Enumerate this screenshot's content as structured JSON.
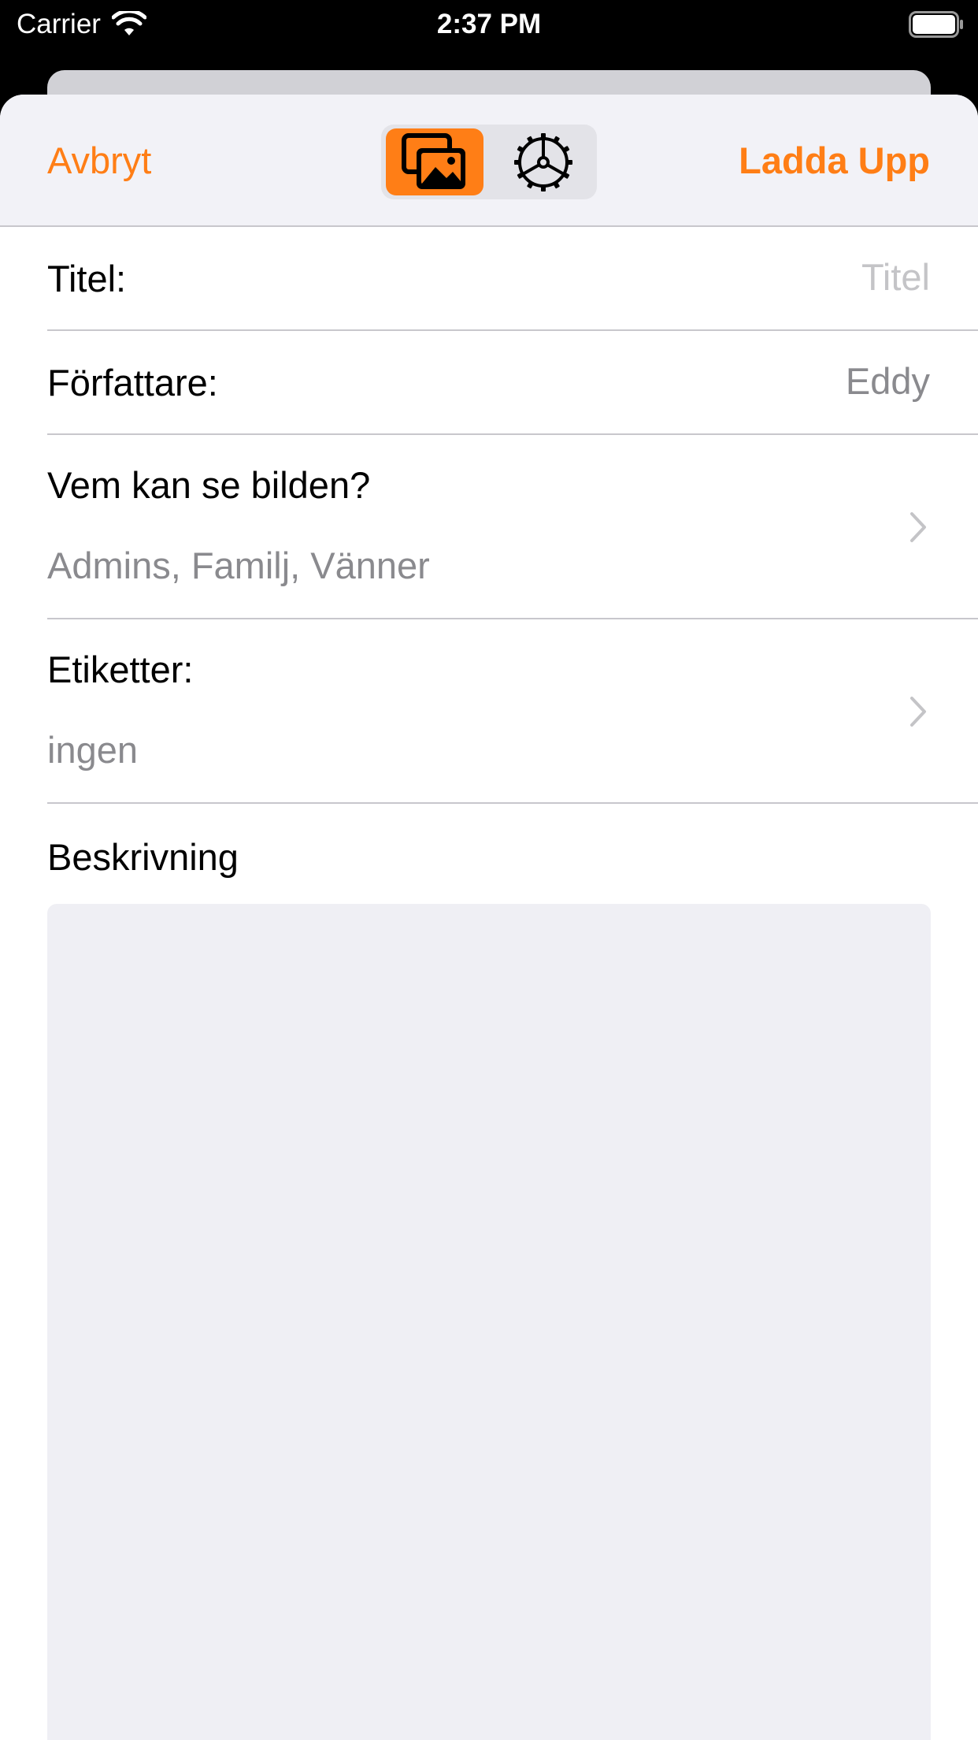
{
  "status_bar": {
    "carrier": "Carrier",
    "time": "2:37 PM"
  },
  "nav": {
    "cancel_label": "Avbryt",
    "upload_label": "Ladda Upp",
    "segments": [
      {
        "icon": "photos-icon",
        "selected": true
      },
      {
        "icon": "settings-gear-icon",
        "selected": false
      }
    ]
  },
  "form": {
    "title": {
      "label": "Titel:",
      "placeholder": "Titel"
    },
    "author": {
      "label": "Författare:",
      "value": "Eddy"
    },
    "visibility": {
      "label": "Vem kan se bilden?",
      "value": "Admins, Familj, Vänner"
    },
    "tags": {
      "label": "Etiketter:",
      "value": "ingen"
    },
    "description": {
      "label": "Beskrivning",
      "value": ""
    }
  },
  "colors": {
    "accent": "#ff7e16",
    "nav_background": "#f2f2f7",
    "separator": "#c8c7cc",
    "secondary_text": "#8a8a8e",
    "placeholder_text": "#c4c4c7",
    "text_area_background": "#efeff4"
  }
}
